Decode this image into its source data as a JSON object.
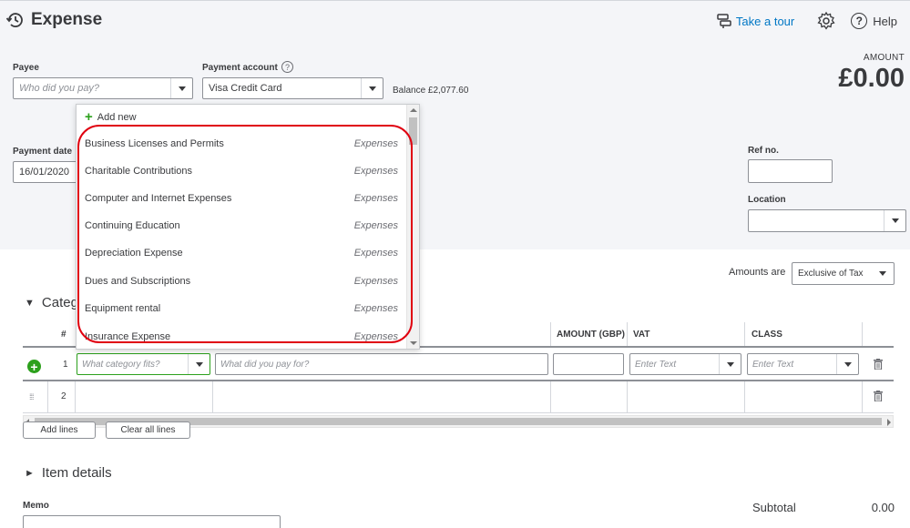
{
  "header": {
    "title": "Expense",
    "take_tour": "Take a tour",
    "help": "Help",
    "amount_label": "AMOUNT",
    "amount_value": "£0.00"
  },
  "form": {
    "payee_label": "Payee",
    "payee_placeholder": "Who did you pay?",
    "payment_account_label": "Payment account",
    "payment_account_value": "Visa Credit Card",
    "balance": "Balance £2,077.60",
    "payment_date_label": "Payment date",
    "payment_date_value": "16/01/2020",
    "ref_label": "Ref no.",
    "location_label": "Location"
  },
  "dropdown": {
    "add_new": "Add new",
    "items": [
      {
        "name": "Business Licenses and Permits",
        "type": "Expenses"
      },
      {
        "name": "Charitable Contributions",
        "type": "Expenses"
      },
      {
        "name": "Computer and Internet Expenses",
        "type": "Expenses"
      },
      {
        "name": "Continuing Education",
        "type": "Expenses"
      },
      {
        "name": "Depreciation Expense",
        "type": "Expenses"
      },
      {
        "name": "Dues and Subscriptions",
        "type": "Expenses"
      },
      {
        "name": "Equipment rental",
        "type": "Expenses"
      },
      {
        "name": "Insurance Expense",
        "type": "Expenses"
      }
    ]
  },
  "category": {
    "section_title": "Categ",
    "amounts_are_label": "Amounts are",
    "amounts_are_value": "Exclusive of Tax",
    "columns": {
      "num": "#",
      "amount": "AMOUNT (GBP)",
      "vat": "VAT",
      "class": "CLASS"
    },
    "rows": [
      "1",
      "2"
    ],
    "category_placeholder": "What category fits?",
    "description_placeholder": "What did you pay for?",
    "vat_placeholder": "Enter Text",
    "class_placeholder": "Enter Text",
    "add_lines": "Add lines",
    "clear_all_lines": "Clear all lines"
  },
  "item_details": {
    "title": "Item details"
  },
  "footer": {
    "memo_label": "Memo",
    "subtotal_label": "Subtotal",
    "subtotal_value": "0.00"
  },
  "colors": {
    "brand_green": "#2ca01c",
    "link_blue": "#0077c5",
    "highlight_red": "#e0000f"
  }
}
